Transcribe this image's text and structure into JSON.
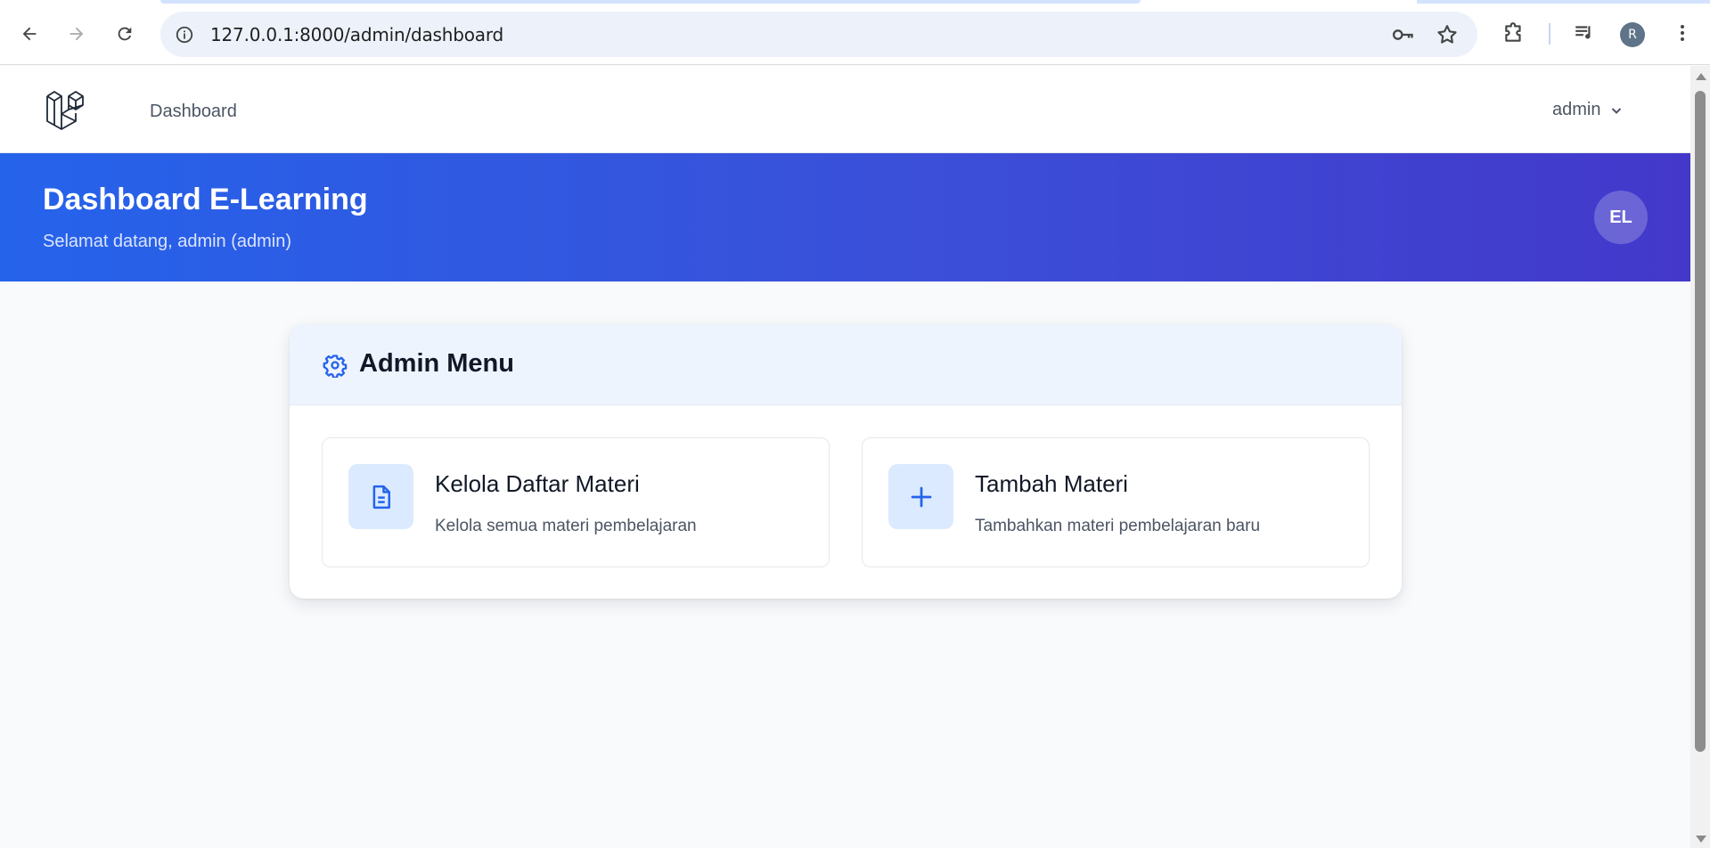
{
  "browser": {
    "url": "127.0.0.1:8000/admin/dashboard",
    "profile_initial": "R",
    "icons": [
      "back-icon",
      "forward-icon",
      "reload-icon",
      "site-info-icon",
      "key-icon",
      "bookmark-star-icon",
      "extensions-icon",
      "media-control-icon",
      "menu-kebab-icon"
    ]
  },
  "navbar": {
    "link_dashboard": "Dashboard",
    "user_name": "admin"
  },
  "hero": {
    "title": "Dashboard E-Learning",
    "subtitle": "Selamat datang, admin (admin)",
    "avatar_initials": "EL"
  },
  "admin_menu": {
    "title": "Admin Menu",
    "items": [
      {
        "title": "Kelola Daftar Materi",
        "description": "Kelola semua materi pembelajaran",
        "icon": "document-icon"
      },
      {
        "title": "Tambah Materi",
        "description": "Tambahkan materi pembelajaran baru",
        "icon": "plus-icon"
      }
    ]
  },
  "colors": {
    "accent": "#2563eb",
    "hero_gradient_start": "#2563eb",
    "hero_gradient_end": "#4338ca",
    "icon_bg": "#dbeafe"
  }
}
